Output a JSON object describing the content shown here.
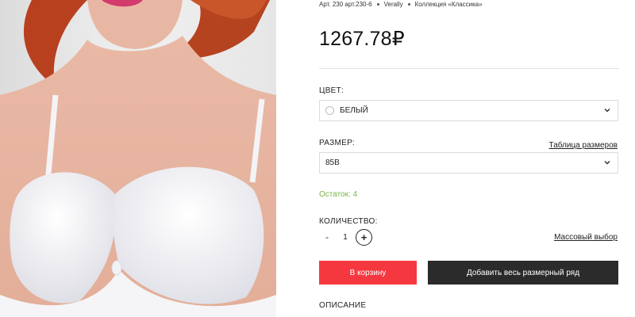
{
  "breadcrumb": {
    "article": "Арт. 230 арт.230-6",
    "brand": "Verally",
    "collection": "Коллекция «Классика»"
  },
  "product": {
    "price": "1267.78₽",
    "stock_text": "Остаток: 4"
  },
  "color": {
    "label": "ЦВЕТ:",
    "selected": "БЕЛЫЙ",
    "swatch_color": "#ffffff"
  },
  "size": {
    "label": "РАЗМЕР:",
    "table_link": "Таблица размеров",
    "selected": "85B"
  },
  "quantity": {
    "label": "КОЛИЧЕСТВО:",
    "minus": "-",
    "value": "1",
    "plus": "+",
    "bulk_link": "Массовый выбор"
  },
  "actions": {
    "add_to_cart": "В корзину",
    "add_size_row": "Добавить весь размерный ряд"
  },
  "description": {
    "label": "ОПИСАНИЕ"
  },
  "colors": {
    "accent": "#f5383f",
    "dark_button": "#2b2b2b",
    "stock_green": "#7ab648"
  },
  "icons": {
    "select_arrow": "chevron-down-icon",
    "color_swatch": "circle"
  }
}
